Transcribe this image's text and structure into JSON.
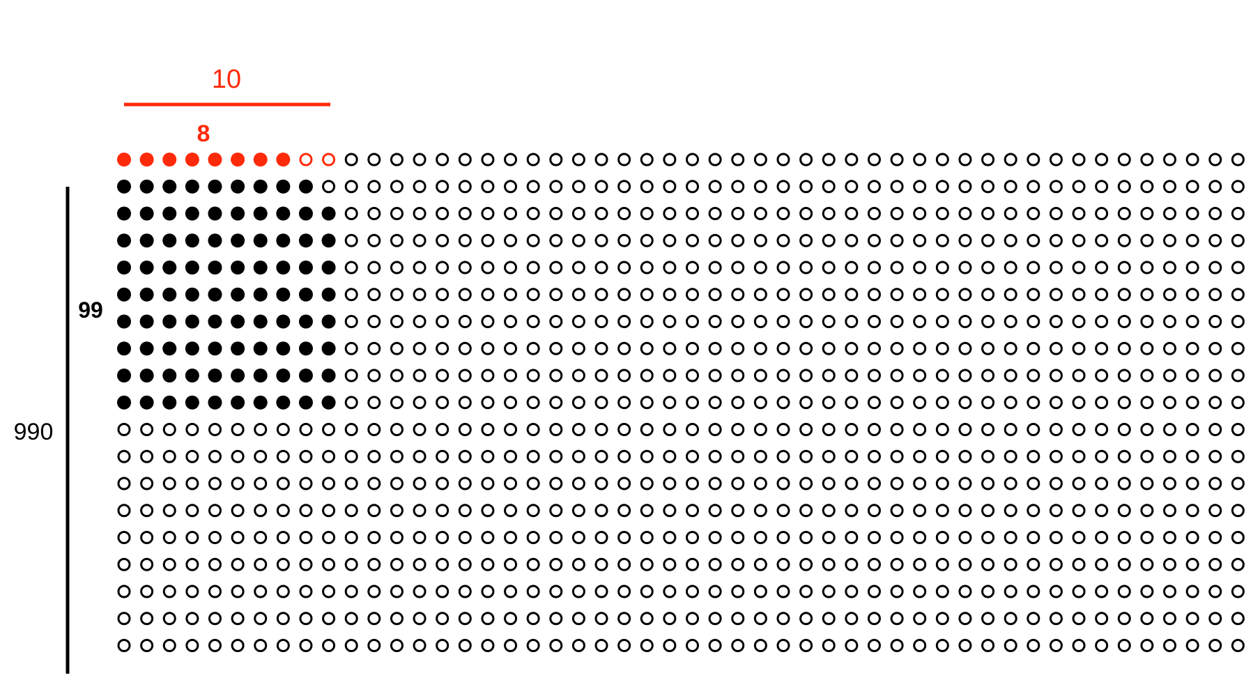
{
  "labels": {
    "fraction_denominator": "10",
    "fraction_numerator": "8",
    "rows_filled": "99",
    "total_count": "990"
  },
  "grid": {
    "rows": 19,
    "columns": 50,
    "first_row_filled": 8,
    "first_row_group": 10,
    "row_two_filled": 9,
    "full_rows_filled": 9,
    "full_row_fill": 10
  },
  "colors": {
    "accent": "#ff2a0a",
    "ink": "#000000",
    "background": "#ffffff"
  }
}
